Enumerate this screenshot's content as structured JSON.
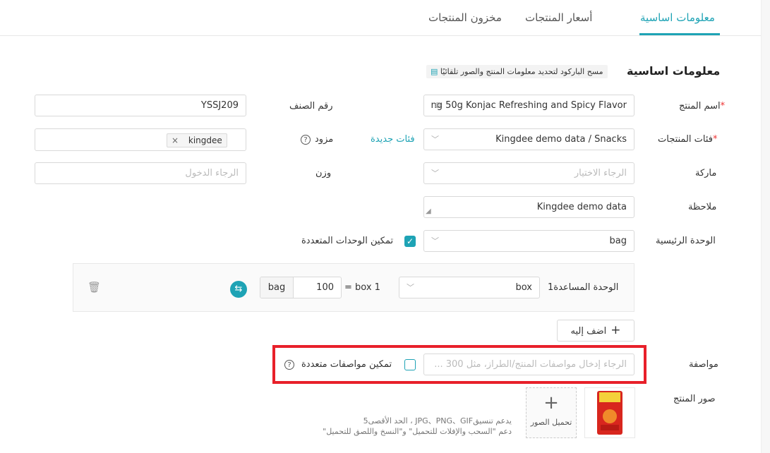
{
  "tabs": [
    {
      "label": "معلومات اساسية",
      "active": true
    },
    {
      "label": "أسعار المنتجات",
      "active": false
    },
    {
      "label": "مخزون المنتجات",
      "active": false
    }
  ],
  "section": {
    "title": "معلومات اساسية",
    "scan_text": "مسح الباركود لتحديد معلومات المنتج والصور تلقائيًا"
  },
  "fields": {
    "product_name": {
      "label": "اسم المنتج",
      "required": "*",
      "value": "ng 50g Konjac Refreshing and Spicy Flavor"
    },
    "item_number": {
      "label": "رقم الصنف",
      "value": "YSSJ209"
    },
    "category": {
      "label": "فئات المنتجات",
      "required": "*",
      "value": "Kingdee demo data / Snacks",
      "new_link": "فئات جديدة"
    },
    "supplier": {
      "label": "مزود",
      "tag": "kingdee",
      "tag_close": "×"
    },
    "brand": {
      "label": "ماركة",
      "placeholder": "الرجاء الاختيار"
    },
    "weight": {
      "label": "وزن",
      "placeholder": "الرجاء الدخول"
    },
    "note": {
      "label": "ملاحظة",
      "value": "Kingdee demo data"
    },
    "main_unit": {
      "label": "الوحدة الرئيسية",
      "value": "bag"
    },
    "multi_unit": {
      "label": "تمكين الوحدات المتعددة",
      "checked": true
    },
    "aux_unit": {
      "label": "الوحدة المساعدة1",
      "value": "box",
      "equation": "= box 1",
      "qty": "100",
      "unit": "bag"
    },
    "add_button": {
      "label": "اضف إليه",
      "icon": "+"
    },
    "spec": {
      "label": "مواصفة",
      "placeholder": "الرجاء إدخال مواصفات المنتج/الطراز، مثل 300 ...",
      "multi_label": "تمكين مواصفات متعددة",
      "checked": false
    },
    "images": {
      "label": "صور المنتج",
      "upload_label": "تحميل الصور",
      "upload_icon": "+",
      "hint1": "يدعم تنسيقJPG、PNG、GIF ، الحد الأقصى5",
      "hint2": "دعم \"السحب والإفلات للتحميل\" و\"النسخ واللصق للتحميل\""
    }
  },
  "colors": {
    "accent": "#1ea3b5",
    "highlight": "#e8202a"
  }
}
